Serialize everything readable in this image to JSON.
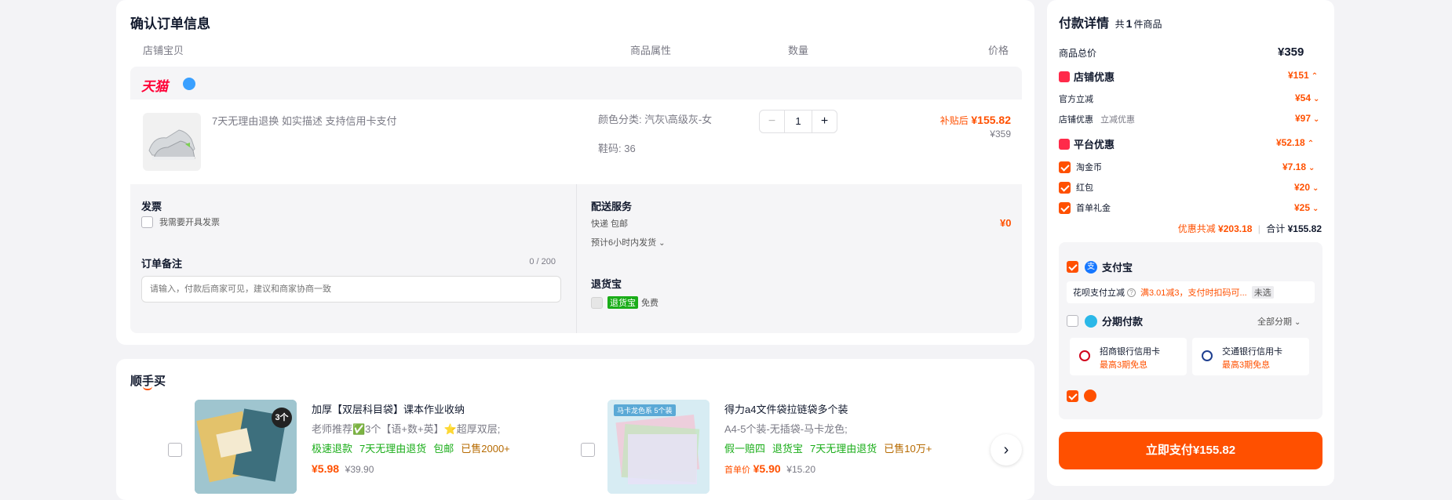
{
  "order": {
    "title": "确认订单信息",
    "columns": {
      "item": "店铺宝贝",
      "attr": "商品属性",
      "qty": "数量",
      "price": "价格"
    },
    "store_logo": "天猫",
    "product": {
      "desc": "7天无理由退换  如实描述  支持信用卡支付",
      "attr_color": "颜色分类: 汽灰\\高级灰-女",
      "attr_size": "鞋码: 36",
      "qty": "1",
      "price_label": "补贴后",
      "price": "¥155.82",
      "orig_price": "¥359"
    },
    "invoice": {
      "title": "发票",
      "option": "我需要开具发票"
    },
    "remark": {
      "title": "订单备注",
      "count": "0 / 200",
      "placeholder": "请输入，付款后商家可见，建议和商家协商一致"
    },
    "delivery": {
      "title": "配送服务",
      "method": "快递 包邮",
      "fee": "¥0",
      "time": "预计6小时内发货"
    },
    "return_ins": {
      "title": "退货宝",
      "badge": "退货宝",
      "free": "免费"
    }
  },
  "shunshou": {
    "title": "顺手买",
    "items": [
      {
        "title": "加厚【双层科目袋】课本作业收纳",
        "sub": "老师推荐✅3个【语+数+英】⭐超厚双层;",
        "tags": [
          "极速退款",
          "7天无理由退货",
          "包邮"
        ],
        "sold": "已售2000+",
        "prefix": "",
        "price": "¥5.98",
        "orig": "¥39.90",
        "thumb_badge": "3个"
      },
      {
        "title": "得力a4文件袋拉链袋多个装",
        "sub": "A4-5个装-无插袋-马卡龙色;",
        "tags": [
          "假一赔四",
          "退货宝",
          "7天无理由退货"
        ],
        "sold": "已售10万+",
        "prefix": "首单价",
        "price": "¥5.90",
        "orig": "¥15.20",
        "thumb_badge": "马卡龙色系 5个装"
      }
    ]
  },
  "payment": {
    "title": "付款详情",
    "count_prefix": "共",
    "count": "1",
    "count_suffix": "件商品",
    "rows": {
      "total_label": "商品总价",
      "total": "¥359",
      "store_disc_label": "店铺优惠",
      "store_disc": "¥151",
      "official_label": "官方立减",
      "official": "¥54",
      "store_coupon_label": "店铺优惠",
      "store_coupon_note": "立减优惠",
      "store_coupon": "¥97",
      "platform_label": "平台优惠",
      "platform": "¥52.18",
      "coin_label": "淘金币",
      "coin": "¥7.18",
      "redpack_label": "红包",
      "redpack": "¥20",
      "firstgift_label": "首单礼金",
      "firstgift": "¥25"
    },
    "summary": {
      "save_label": "优惠共减",
      "save": "¥203.18",
      "total_label": "合计",
      "total": "¥155.82"
    },
    "methods": {
      "alipay": "支付宝",
      "huabei_label": "花呗支付立减",
      "huabei_promo": "满3.01减3，支付时扣码可...",
      "huabei_status": "未选",
      "installment": "分期付款",
      "installment_opt": "全部分期",
      "banks": [
        {
          "name": "招商银行信用卡",
          "note": "最高3期免息"
        },
        {
          "name": "交通银行信用卡",
          "note": "最高3期免息"
        }
      ]
    },
    "pay_button": "立即支付¥155.82"
  },
  "colors": {
    "accent": "#ff5000",
    "alipay": "#1677ff",
    "green": "#1aad19"
  }
}
